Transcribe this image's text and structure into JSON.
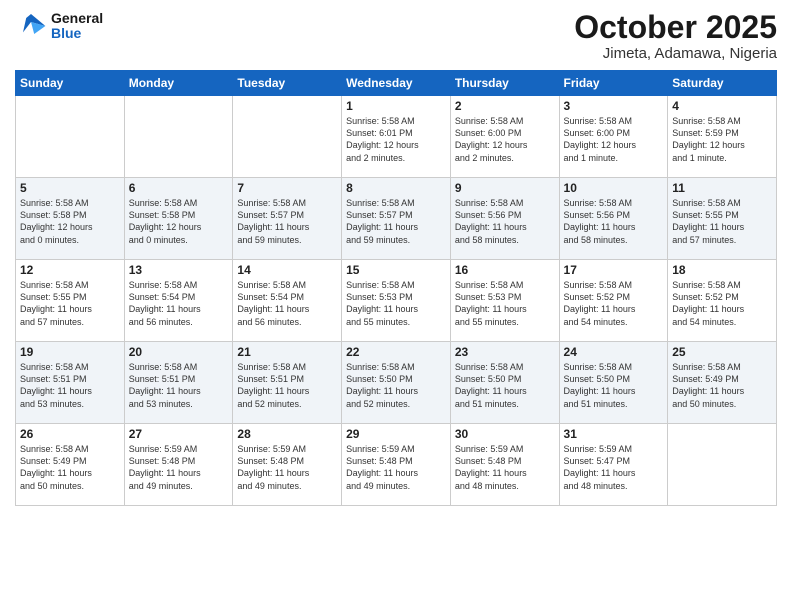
{
  "header": {
    "logo_line1": "General",
    "logo_line2": "Blue",
    "month": "October 2025",
    "location": "Jimeta, Adamawa, Nigeria"
  },
  "weekdays": [
    "Sunday",
    "Monday",
    "Tuesday",
    "Wednesday",
    "Thursday",
    "Friday",
    "Saturday"
  ],
  "weeks": [
    [
      {
        "day": "",
        "info": ""
      },
      {
        "day": "",
        "info": ""
      },
      {
        "day": "",
        "info": ""
      },
      {
        "day": "1",
        "info": "Sunrise: 5:58 AM\nSunset: 6:01 PM\nDaylight: 12 hours\nand 2 minutes."
      },
      {
        "day": "2",
        "info": "Sunrise: 5:58 AM\nSunset: 6:00 PM\nDaylight: 12 hours\nand 2 minutes."
      },
      {
        "day": "3",
        "info": "Sunrise: 5:58 AM\nSunset: 6:00 PM\nDaylight: 12 hours\nand 1 minute."
      },
      {
        "day": "4",
        "info": "Sunrise: 5:58 AM\nSunset: 5:59 PM\nDaylight: 12 hours\nand 1 minute."
      }
    ],
    [
      {
        "day": "5",
        "info": "Sunrise: 5:58 AM\nSunset: 5:58 PM\nDaylight: 12 hours\nand 0 minutes."
      },
      {
        "day": "6",
        "info": "Sunrise: 5:58 AM\nSunset: 5:58 PM\nDaylight: 12 hours\nand 0 minutes."
      },
      {
        "day": "7",
        "info": "Sunrise: 5:58 AM\nSunset: 5:57 PM\nDaylight: 11 hours\nand 59 minutes."
      },
      {
        "day": "8",
        "info": "Sunrise: 5:58 AM\nSunset: 5:57 PM\nDaylight: 11 hours\nand 59 minutes."
      },
      {
        "day": "9",
        "info": "Sunrise: 5:58 AM\nSunset: 5:56 PM\nDaylight: 11 hours\nand 58 minutes."
      },
      {
        "day": "10",
        "info": "Sunrise: 5:58 AM\nSunset: 5:56 PM\nDaylight: 11 hours\nand 58 minutes."
      },
      {
        "day": "11",
        "info": "Sunrise: 5:58 AM\nSunset: 5:55 PM\nDaylight: 11 hours\nand 57 minutes."
      }
    ],
    [
      {
        "day": "12",
        "info": "Sunrise: 5:58 AM\nSunset: 5:55 PM\nDaylight: 11 hours\nand 57 minutes."
      },
      {
        "day": "13",
        "info": "Sunrise: 5:58 AM\nSunset: 5:54 PM\nDaylight: 11 hours\nand 56 minutes."
      },
      {
        "day": "14",
        "info": "Sunrise: 5:58 AM\nSunset: 5:54 PM\nDaylight: 11 hours\nand 56 minutes."
      },
      {
        "day": "15",
        "info": "Sunrise: 5:58 AM\nSunset: 5:53 PM\nDaylight: 11 hours\nand 55 minutes."
      },
      {
        "day": "16",
        "info": "Sunrise: 5:58 AM\nSunset: 5:53 PM\nDaylight: 11 hours\nand 55 minutes."
      },
      {
        "day": "17",
        "info": "Sunrise: 5:58 AM\nSunset: 5:52 PM\nDaylight: 11 hours\nand 54 minutes."
      },
      {
        "day": "18",
        "info": "Sunrise: 5:58 AM\nSunset: 5:52 PM\nDaylight: 11 hours\nand 54 minutes."
      }
    ],
    [
      {
        "day": "19",
        "info": "Sunrise: 5:58 AM\nSunset: 5:51 PM\nDaylight: 11 hours\nand 53 minutes."
      },
      {
        "day": "20",
        "info": "Sunrise: 5:58 AM\nSunset: 5:51 PM\nDaylight: 11 hours\nand 53 minutes."
      },
      {
        "day": "21",
        "info": "Sunrise: 5:58 AM\nSunset: 5:51 PM\nDaylight: 11 hours\nand 52 minutes."
      },
      {
        "day": "22",
        "info": "Sunrise: 5:58 AM\nSunset: 5:50 PM\nDaylight: 11 hours\nand 52 minutes."
      },
      {
        "day": "23",
        "info": "Sunrise: 5:58 AM\nSunset: 5:50 PM\nDaylight: 11 hours\nand 51 minutes."
      },
      {
        "day": "24",
        "info": "Sunrise: 5:58 AM\nSunset: 5:50 PM\nDaylight: 11 hours\nand 51 minutes."
      },
      {
        "day": "25",
        "info": "Sunrise: 5:58 AM\nSunset: 5:49 PM\nDaylight: 11 hours\nand 50 minutes."
      }
    ],
    [
      {
        "day": "26",
        "info": "Sunrise: 5:58 AM\nSunset: 5:49 PM\nDaylight: 11 hours\nand 50 minutes."
      },
      {
        "day": "27",
        "info": "Sunrise: 5:59 AM\nSunset: 5:48 PM\nDaylight: 11 hours\nand 49 minutes."
      },
      {
        "day": "28",
        "info": "Sunrise: 5:59 AM\nSunset: 5:48 PM\nDaylight: 11 hours\nand 49 minutes."
      },
      {
        "day": "29",
        "info": "Sunrise: 5:59 AM\nSunset: 5:48 PM\nDaylight: 11 hours\nand 49 minutes."
      },
      {
        "day": "30",
        "info": "Sunrise: 5:59 AM\nSunset: 5:48 PM\nDaylight: 11 hours\nand 48 minutes."
      },
      {
        "day": "31",
        "info": "Sunrise: 5:59 AM\nSunset: 5:47 PM\nDaylight: 11 hours\nand 48 minutes."
      },
      {
        "day": "",
        "info": ""
      }
    ]
  ]
}
